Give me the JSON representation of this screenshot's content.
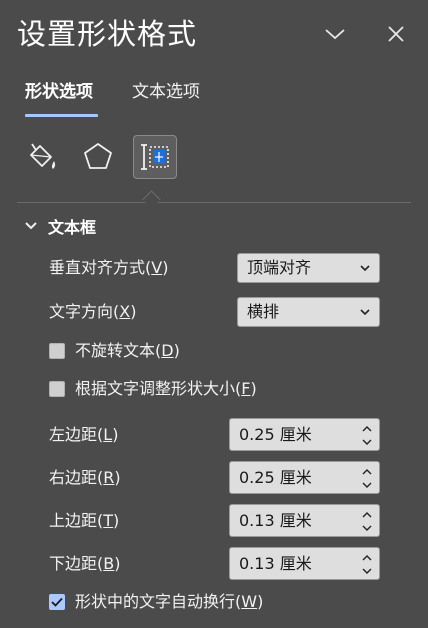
{
  "header": {
    "title": "设置形状格式",
    "collapse_icon": "chevron-down-icon",
    "close_icon": "close-icon"
  },
  "tabs": [
    {
      "label": "形状选项",
      "active": true
    },
    {
      "label": "文本选项",
      "active": false
    }
  ],
  "category_icons": [
    "fill-line-icon",
    "effects-pentagon-icon",
    "size-properties-icon"
  ],
  "selected_category": 2,
  "section": {
    "title": "文本框",
    "expanded": true
  },
  "vertical_alignment": {
    "label": "垂直对齐方式",
    "hotkey": "V",
    "value": "顶端对齐"
  },
  "text_direction": {
    "label": "文字方向",
    "hotkey": "X",
    "value": "横排"
  },
  "checkbox_no_rotate": {
    "label": "不旋转文本",
    "hotkey": "D",
    "checked": false
  },
  "checkbox_autofit": {
    "label": "根据文字调整形状大小",
    "hotkey": "F",
    "checked": false
  },
  "margins": [
    {
      "label": "左边距",
      "hotkey": "L",
      "value": "0.25 厘米"
    },
    {
      "label": "右边距",
      "hotkey": "R",
      "value": "0.25 厘米"
    },
    {
      "label": "上边距",
      "hotkey": "T",
      "value": "0.13 厘米"
    },
    {
      "label": "下边距",
      "hotkey": "B",
      "value": "0.13 厘米"
    }
  ],
  "checkbox_wrap": {
    "label": "形状中的文字自动换行",
    "hotkey": "W",
    "checked": true
  },
  "colors": {
    "background": "#4b4b4b",
    "accent": "#a6c8ff",
    "control_bg": "#dedede"
  }
}
